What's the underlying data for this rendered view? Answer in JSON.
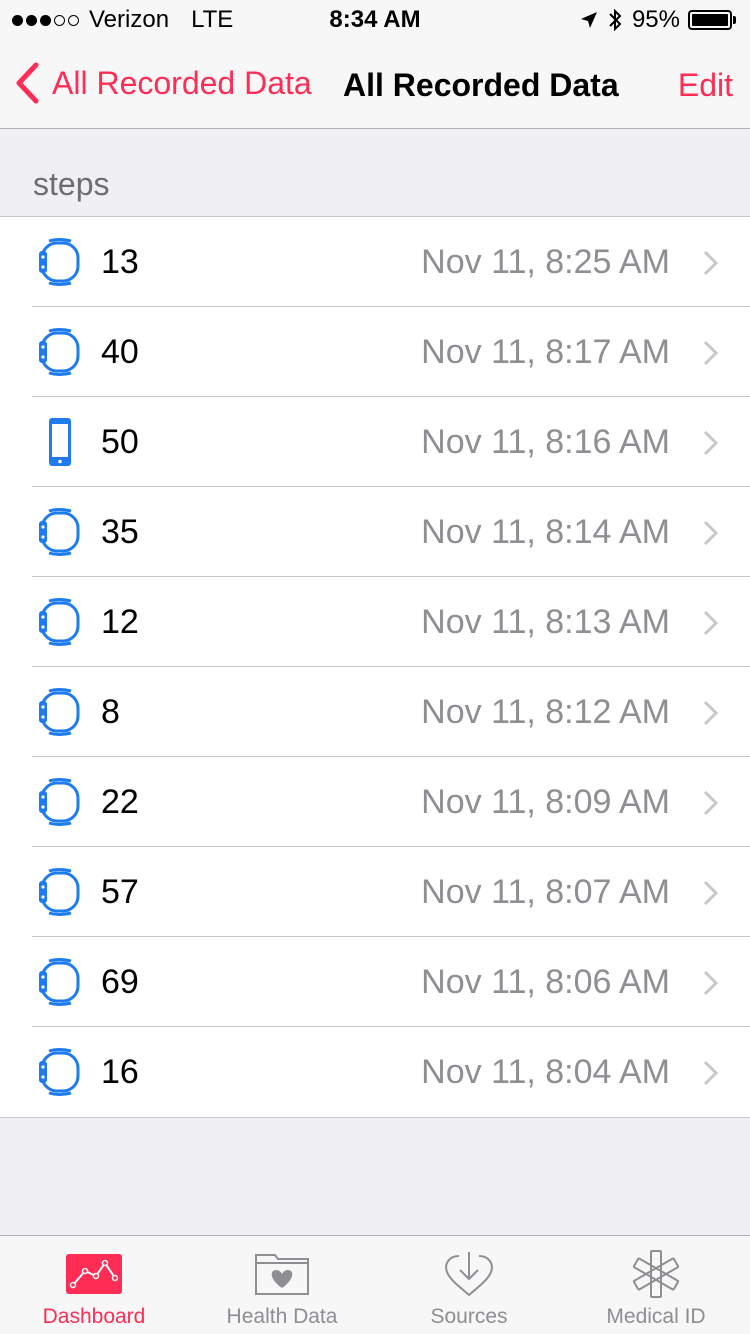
{
  "status": {
    "carrier": "Verizon",
    "network": "LTE",
    "time": "8:34 AM",
    "battery": "95%",
    "battery_level": 0.95
  },
  "nav": {
    "back_label": "All Recorded Data",
    "title": "All Recorded Data",
    "edit_label": "Edit"
  },
  "section": {
    "title": "steps"
  },
  "rows": [
    {
      "value": "13",
      "date": "Nov 11, 8:25 AM",
      "device": "watch-icon"
    },
    {
      "value": "40",
      "date": "Nov 11, 8:17 AM",
      "device": "watch-icon"
    },
    {
      "value": "50",
      "date": "Nov 11, 8:16 AM",
      "device": "iphone-icon"
    },
    {
      "value": "35",
      "date": "Nov 11, 8:14 AM",
      "device": "watch-icon"
    },
    {
      "value": "12",
      "date": "Nov 11, 8:13 AM",
      "device": "watch-icon"
    },
    {
      "value": "8",
      "date": "Nov 11, 8:12 AM",
      "device": "watch-icon"
    },
    {
      "value": "22",
      "date": "Nov 11, 8:09 AM",
      "device": "watch-icon"
    },
    {
      "value": "57",
      "date": "Nov 11, 8:07 AM",
      "device": "watch-icon"
    },
    {
      "value": "69",
      "date": "Nov 11, 8:06 AM",
      "device": "watch-icon"
    },
    {
      "value": "16",
      "date": "Nov 11, 8:04 AM",
      "device": "watch-icon"
    }
  ],
  "tabs": [
    {
      "label": "Dashboard",
      "icon": "dashboard-icon",
      "active": true
    },
    {
      "label": "Health Data",
      "icon": "health-data-icon",
      "active": false
    },
    {
      "label": "Sources",
      "icon": "sources-icon",
      "active": false
    },
    {
      "label": "Medical ID",
      "icon": "medical-id-icon",
      "active": false
    }
  ],
  "colors": {
    "accent": "#ff2d55",
    "device_blue": "#1e7cf0",
    "secondary_text": "#8e8e93",
    "background": "#efeff4"
  }
}
